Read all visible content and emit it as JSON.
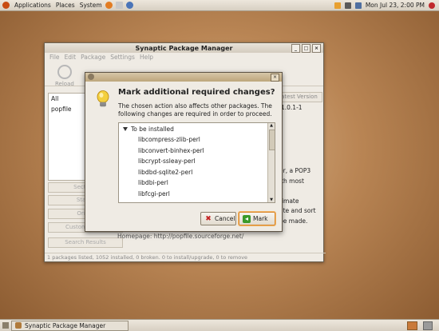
{
  "topbar": {
    "menus": [
      "Applications",
      "Places",
      "System"
    ],
    "datetime": "Mon Jul 23,  2:00 PM"
  },
  "taskbar": {
    "task_label": "Synaptic Package Manager"
  },
  "main_window": {
    "title": "Synaptic Package Manager",
    "menus": [
      "File",
      "Edit",
      "Package",
      "Settings",
      "Help"
    ],
    "reload_label": "Reload",
    "left_list": [
      "All",
      "popfile"
    ],
    "side_buttons": [
      "Sections",
      "Status",
      "Origin",
      "Custom Filters",
      "Search Results"
    ],
    "latest_version_header": "Latest Version",
    "latest_version_value": "1.0.1-1",
    "description_lines": [
      "er, a POP3",
      "ith most",
      "",
      "timate",
      "ate and sort",
      "be made."
    ],
    "homepage": "Homepage: http://popfile.sourceforge.net/",
    "status": "1 packages listed, 1052 installed, 0 broken. 0 to install/upgrade, 0 to remove"
  },
  "dialog": {
    "heading": "Mark additional required changes?",
    "text": "The chosen action also affects other packages. The following changes are required in order to proceed.",
    "group_label": "To be installed",
    "packages": [
      "libcompress-zlib-perl",
      "libconvert-binhex-perl",
      "libcrypt-ssleay-perl",
      "libdbd-sqlite2-perl",
      "libdbi-perl",
      "libfcgi-perl"
    ],
    "cancel_label": "Cancel",
    "mark_label": "Mark"
  },
  "icons": {
    "bulb": "lightbulb-icon",
    "cancel": "cancel-icon",
    "mark": "mark-icon"
  }
}
